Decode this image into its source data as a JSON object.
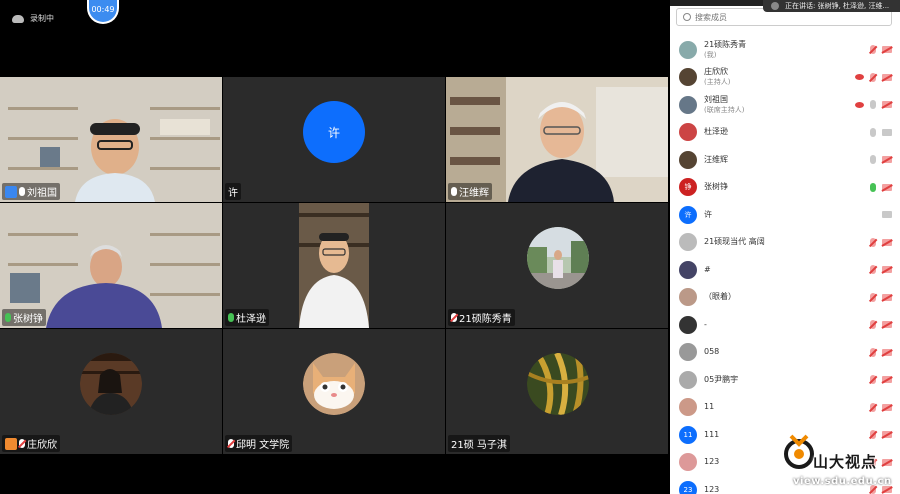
{
  "topbar": {
    "recording_label": "录制中",
    "timer": "00:49"
  },
  "tiles": [
    {
      "name": "刘祖国",
      "mic": "white",
      "host": true,
      "host_color": "#3a87f0"
    },
    {
      "name": "许",
      "avatar_letter": "许"
    },
    {
      "name": "汪维辉",
      "mic": "white"
    },
    {
      "name": "张树铮",
      "mic": "green"
    },
    {
      "name": "杜泽逊",
      "mic": "green"
    },
    {
      "name": "21硕陈秀青",
      "mic": "muted"
    },
    {
      "name": "庄欣欣",
      "mic": "muted",
      "host": true,
      "host_color": "#f08a30"
    },
    {
      "name": "邱明 文学院",
      "mic": "muted"
    },
    {
      "name": "21硕 马子淇"
    }
  ],
  "panel": {
    "search_placeholder": "搜索成员",
    "members": [
      {
        "name": "21硕陈秀青",
        "role": "(我)",
        "mic": "red",
        "cam": "red",
        "avatar": "#8aa"
      },
      {
        "name": "庄欣欣",
        "role": "(主持人)",
        "mic": "red",
        "cam": "red",
        "eye": true,
        "avatar": "#543"
      },
      {
        "name": "刘祖国",
        "role": "(联席主持人)",
        "mic": "gray",
        "cam": "red",
        "eye": true,
        "avatar": "#678"
      },
      {
        "name": "杜泽逊",
        "role": "",
        "mic": "gray",
        "cam": "gray",
        "avatar": "#c44"
      },
      {
        "name": "汪维辉",
        "role": "",
        "mic": "gray",
        "cam": "red",
        "avatar": "#543"
      },
      {
        "name": "张树铮",
        "role": "",
        "mic": "green",
        "cam": "red",
        "avatar": "#c22",
        "avatar_text": "铮"
      },
      {
        "name": "许",
        "role": "",
        "mic": "none",
        "cam": "gray",
        "avatar": "#0d6efd",
        "avatar_text": "许"
      },
      {
        "name": "21硕现当代 高阔",
        "role": "",
        "mic": "red",
        "cam": "red",
        "avatar": "#bbb"
      },
      {
        "name": "#",
        "role": "",
        "mic": "red",
        "cam": "red",
        "avatar": "#446"
      },
      {
        "name": "（眼着）",
        "role": "",
        "mic": "red",
        "cam": "red",
        "avatar": "#b98"
      },
      {
        "name": "-",
        "role": "",
        "mic": "red",
        "cam": "red",
        "avatar": "#333"
      },
      {
        "name": "058",
        "role": "",
        "mic": "red",
        "cam": "red",
        "avatar": "#999"
      },
      {
        "name": "05尹鹏宇",
        "role": "",
        "mic": "red",
        "cam": "red",
        "avatar": "#aaa"
      },
      {
        "name": "11",
        "role": "",
        "mic": "red",
        "cam": "red",
        "avatar": "#c98"
      },
      {
        "name": "111",
        "role": "",
        "mic": "red",
        "cam": "red",
        "avatar": "#0d6efd",
        "avatar_text": "11"
      },
      {
        "name": "123",
        "role": "",
        "mic": "red",
        "cam": "red",
        "avatar": "#d99"
      },
      {
        "name": "123",
        "role": "",
        "mic": "red",
        "cam": "red",
        "avatar": "#0d6efd",
        "avatar_text": "23"
      }
    ]
  },
  "toast": "正在讲话: 张树铮, 杜泽逊, 汪维...",
  "watermark": {
    "brand": "山大视点",
    "url": "view.sdu.edu.cn"
  }
}
